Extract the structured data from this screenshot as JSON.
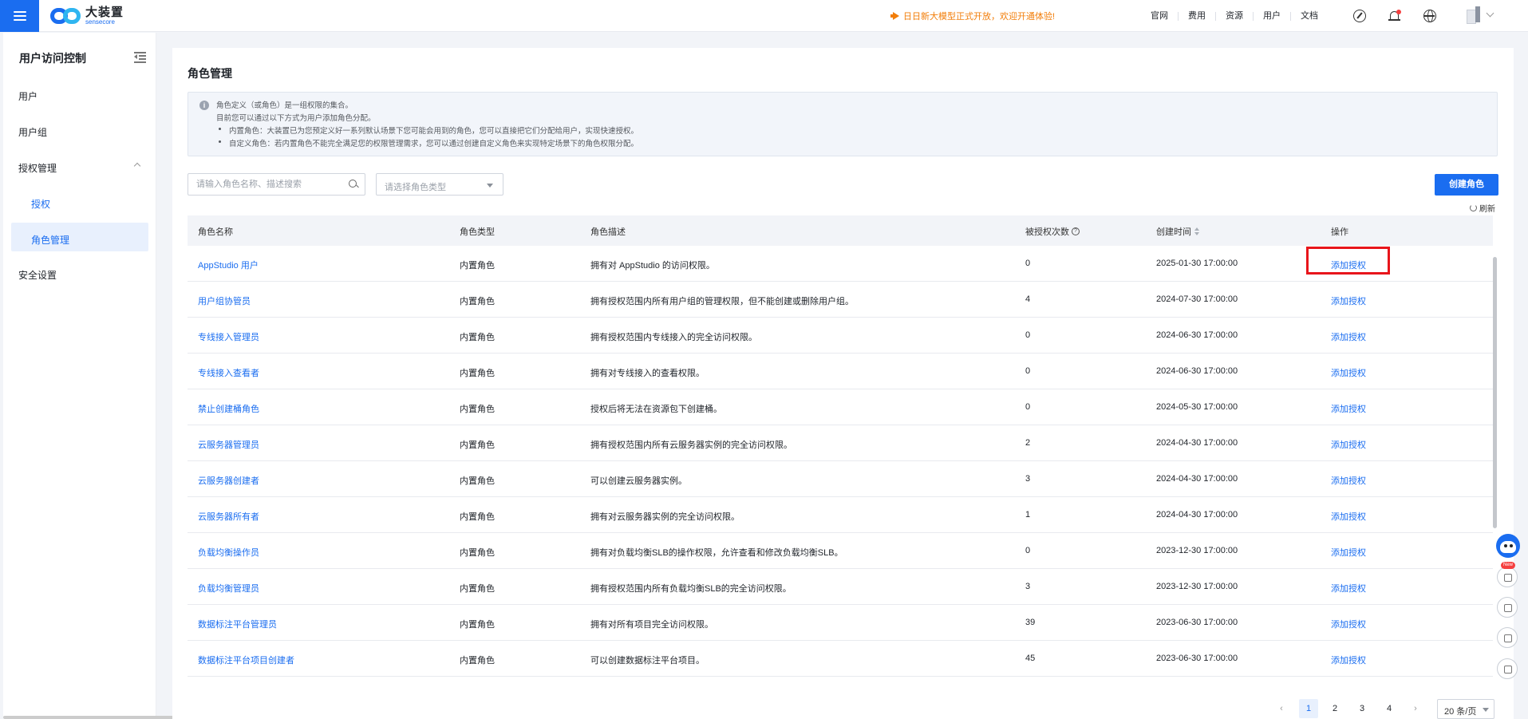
{
  "header": {
    "logo_cn": "大装置",
    "logo_en": "sensecore",
    "announcement": "日日新大模型正式开放，欢迎开通体验!",
    "nav": [
      "官网",
      "费用",
      "资源",
      "用户",
      "文档"
    ]
  },
  "sidebar": {
    "title": "用户访问控制",
    "items": {
      "users": "用户",
      "groups": "用户组",
      "auth_mgmt": "授权管理",
      "auth": "授权",
      "roles": "角色管理",
      "security": "安全设置"
    }
  },
  "main": {
    "title": "角色管理",
    "info": {
      "line1": "角色定义（或角色）是一组权限的集合。",
      "line2": "目前您可以通过以下方式为用户添加角色分配。",
      "bullet1": "内置角色：大装置已为您预定义好一系列默认场景下您可能会用到的角色，您可以直接把它们分配给用户，实现快速授权。",
      "bullet2": "自定义角色：若内置角色不能完全满足您的权限管理需求，您可以通过创建自定义角色来实现特定场景下的角色权限分配。"
    },
    "search_placeholder": "请输入角色名称、描述搜索",
    "type_placeholder": "请选择角色类型",
    "create_button": "创建角色",
    "refresh": "刷新"
  },
  "table": {
    "columns": [
      "角色名称",
      "角色类型",
      "角色描述",
      "被授权次数",
      "创建时间",
      "操作"
    ],
    "rows": [
      {
        "name": "AppStudio 用户",
        "type": "内置角色",
        "desc": "拥有对 AppStudio 的访问权限。",
        "count": "0",
        "created": "2025-01-30 17:00:00",
        "action": "添加授权"
      },
      {
        "name": "用户组协管员",
        "type": "内置角色",
        "desc": "拥有授权范围内所有用户组的管理权限，但不能创建或删除用户组。",
        "count": "4",
        "created": "2024-07-30 17:00:00",
        "action": "添加授权"
      },
      {
        "name": "专线接入管理员",
        "type": "内置角色",
        "desc": "拥有授权范围内专线接入的完全访问权限。",
        "count": "0",
        "created": "2024-06-30 17:00:00",
        "action": "添加授权"
      },
      {
        "name": "专线接入查看者",
        "type": "内置角色",
        "desc": "拥有对专线接入的查看权限。",
        "count": "0",
        "created": "2024-06-30 17:00:00",
        "action": "添加授权"
      },
      {
        "name": "禁止创建桶角色",
        "type": "内置角色",
        "desc": "授权后将无法在资源包下创建桶。",
        "count": "0",
        "created": "2024-05-30 17:00:00",
        "action": "添加授权"
      },
      {
        "name": "云服务器管理员",
        "type": "内置角色",
        "desc": "拥有授权范围内所有云服务器实例的完全访问权限。",
        "count": "2",
        "created": "2024-04-30 17:00:00",
        "action": "添加授权"
      },
      {
        "name": "云服务器创建者",
        "type": "内置角色",
        "desc": "可以创建云服务器实例。",
        "count": "3",
        "created": "2024-04-30 17:00:00",
        "action": "添加授权"
      },
      {
        "name": "云服务器所有者",
        "type": "内置角色",
        "desc": "拥有对云服务器实例的完全访问权限。",
        "count": "1",
        "created": "2024-04-30 17:00:00",
        "action": "添加授权"
      },
      {
        "name": "负载均衡操作员",
        "type": "内置角色",
        "desc": "拥有对负载均衡SLB的操作权限，允许查看和修改负载均衡SLB。",
        "count": "0",
        "created": "2023-12-30 17:00:00",
        "action": "添加授权"
      },
      {
        "name": "负载均衡管理员",
        "type": "内置角色",
        "desc": "拥有授权范围内所有负载均衡SLB的完全访问权限。",
        "count": "3",
        "created": "2023-12-30 17:00:00",
        "action": "添加授权"
      },
      {
        "name": "数据标注平台管理员",
        "type": "内置角色",
        "desc": "拥有对所有项目完全访问权限。",
        "count": "39",
        "created": "2023-06-30 17:00:00",
        "action": "添加授权"
      },
      {
        "name": "数据标注平台项目创建者",
        "type": "内置角色",
        "desc": "可以创建数据标注平台项目。",
        "count": "45",
        "created": "2023-06-30 17:00:00",
        "action": "添加授权"
      }
    ]
  },
  "pagination": {
    "prev": "‹",
    "pages": [
      "1",
      "2",
      "3",
      "4"
    ],
    "next": "›",
    "page_size": "20 条/页"
  },
  "floating": {
    "new_badge": "New"
  }
}
